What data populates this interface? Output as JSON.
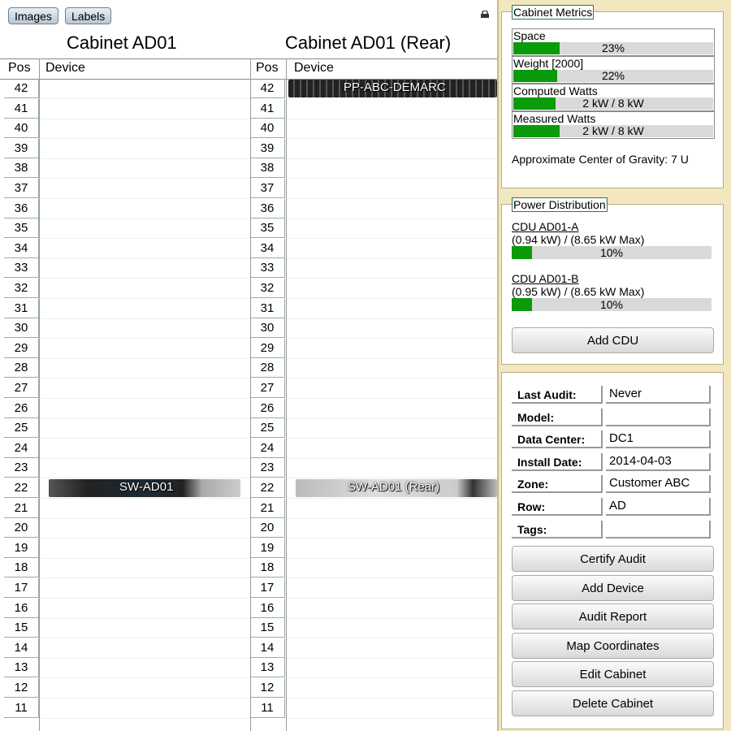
{
  "toolbar": {
    "images_label": "Images",
    "labels_label": "Labels"
  },
  "front": {
    "title": "Cabinet AD01",
    "pos_header": "Pos",
    "device_header": "Device"
  },
  "rear": {
    "title": "Cabinet AD01 (Rear)",
    "pos_header": "Pos",
    "device_header": "Device"
  },
  "positions": [
    "42",
    "41",
    "40",
    "39",
    "38",
    "37",
    "36",
    "35",
    "34",
    "33",
    "32",
    "31",
    "30",
    "29",
    "28",
    "27",
    "26",
    "25",
    "24",
    "23",
    "22",
    "21",
    "20",
    "19",
    "18",
    "17",
    "16",
    "15",
    "14",
    "13",
    "12",
    "11"
  ],
  "devices": {
    "front_22": "SW-AD01",
    "rear_42": "PP-ABC-DEMARC",
    "rear_22": "SW-AD01 (Rear)"
  },
  "metrics": {
    "legend": "Cabinet Metrics",
    "items": [
      {
        "label": "Space",
        "value": "23%",
        "fraction": 0.23
      },
      {
        "label": "Weight [2000]",
        "value": "22%",
        "fraction": 0.22
      },
      {
        "label": "Computed Watts",
        "value": "2 kW / 8 kW",
        "fraction": 0.21
      },
      {
        "label": "Measured Watts",
        "value": "2 kW / 8 kW",
        "fraction": 0.23
      }
    ],
    "center_of_gravity": "Approximate Center of Gravity: 7 U"
  },
  "power": {
    "legend": "Power Distribution",
    "cdus": [
      {
        "name": "CDU AD01-A",
        "load": "(0.94 kW) / (8.65 kW Max)",
        "percent": "10%",
        "fraction": 0.1
      },
      {
        "name": "CDU AD01-B",
        "load": "(0.95 kW) / (8.65 kW Max)",
        "percent": "10%",
        "fraction": 0.1
      }
    ],
    "add_cdu": "Add CDU"
  },
  "info": {
    "rows": [
      {
        "label": "Last Audit:",
        "value": "Never"
      },
      {
        "label": "Model:",
        "value": ""
      },
      {
        "label": "Data Center:",
        "value": "DC1"
      },
      {
        "label": "Install Date:",
        "value": "2014-04-03"
      },
      {
        "label": "Zone:",
        "value": "Customer ABC"
      },
      {
        "label": "Row:",
        "value": "AD"
      },
      {
        "label": "Tags:",
        "value": ""
      }
    ],
    "buttons": [
      "Certify Audit",
      "Add Device",
      "Audit Report",
      "Map Coordinates",
      "Edit Cabinet",
      "Delete Cabinet"
    ]
  },
  "colors": {
    "background": "#f3e7bf",
    "bar_fill": "#0a9a0a",
    "bar_track": "#d9d9d9"
  }
}
